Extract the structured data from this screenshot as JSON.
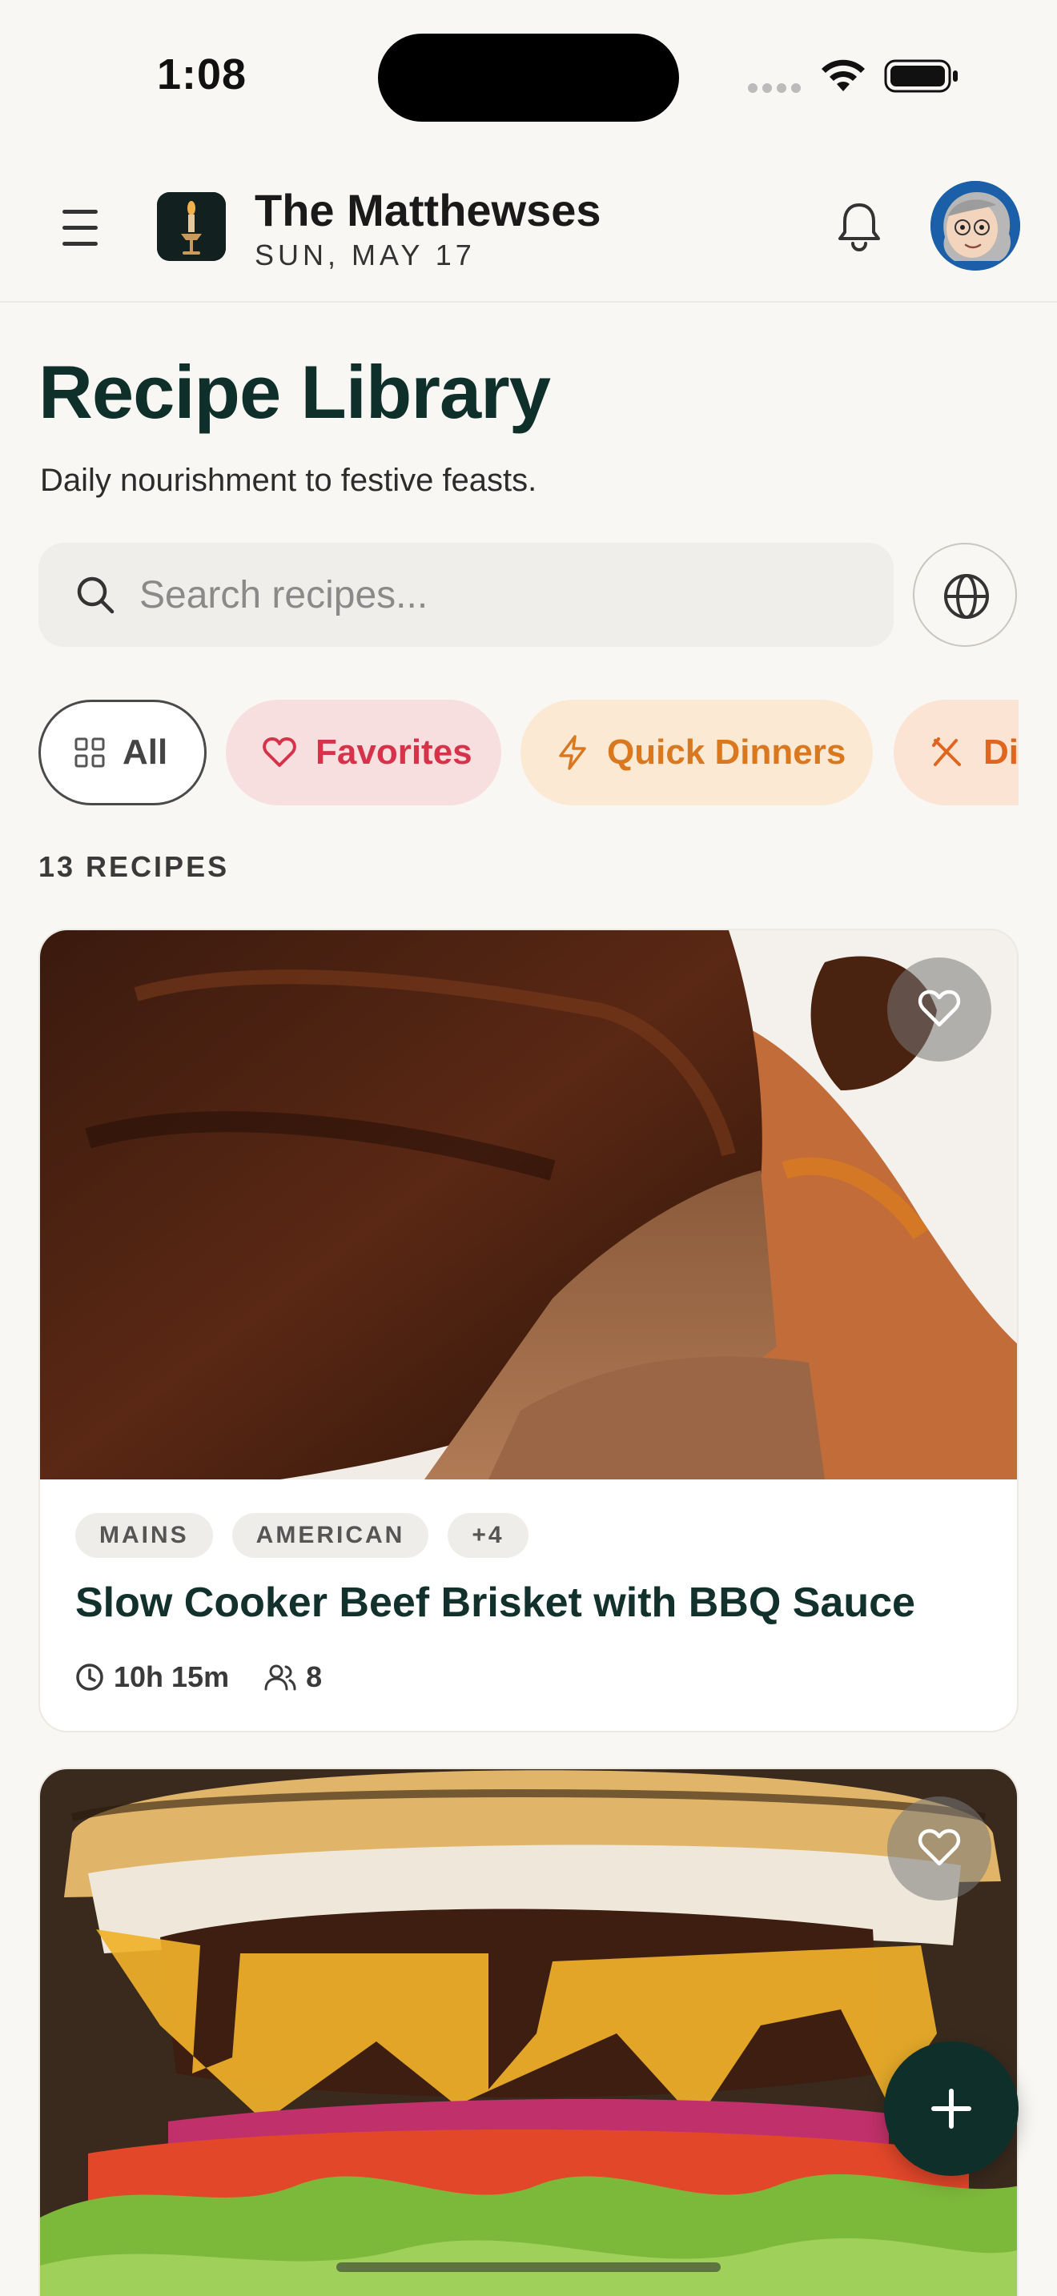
{
  "status_bar": {
    "time": "1:08"
  },
  "header": {
    "household_name": "The Matthewses",
    "date": "SUN, MAY 17",
    "icons": {
      "menu": "menu-icon",
      "logo": "candle-logo",
      "bell": "bell-icon",
      "avatar": "user-avatar"
    }
  },
  "page": {
    "title": "Recipe Library",
    "subtitle": "Daily nourishment to festive feasts."
  },
  "search": {
    "placeholder": "Search recipes...",
    "value": ""
  },
  "filters": [
    {
      "label": "All",
      "icon": "grid-icon",
      "selected": true
    },
    {
      "label": "Favorites",
      "icon": "heart-icon",
      "color": "#d6334a"
    },
    {
      "label": "Quick Dinners",
      "icon": "lightning-icon",
      "color": "#d9781e"
    },
    {
      "label": "Di",
      "icon": "utensils-icon",
      "color": "#e0651e"
    }
  ],
  "recipe_count": "13 RECIPES",
  "recipes": [
    {
      "tags": [
        "MAINS",
        "AMERICAN",
        "+4"
      ],
      "title": "Slow Cooker Beef Brisket with BBQ Sauce",
      "time": "10h 15m",
      "servings": "8",
      "favorited": false
    },
    {
      "favorited": false
    }
  ],
  "colors": {
    "primary": "#0f2f2b",
    "background": "#f9f7f4",
    "favorites": "#d6334a",
    "quick": "#d9781e"
  }
}
